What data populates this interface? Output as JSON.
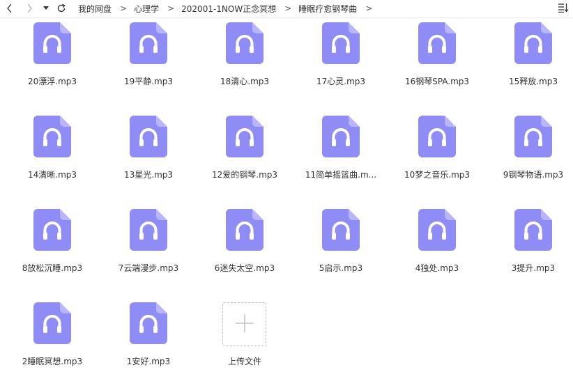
{
  "toolbar": {
    "back_icon": "chevron-left-icon",
    "forward_icon": "chevron-right-icon",
    "history_icon": "caret-down-icon",
    "refresh_icon": "refresh-icon",
    "sort_icon": "sort-icon"
  },
  "breadcrumb": {
    "items": [
      "我的网盘",
      "心理学",
      "202001-1NOW正念冥想",
      "睡眠疗愈钢琴曲"
    ],
    "separator": ">"
  },
  "files": [
    {
      "name": "20漂浮.mp3"
    },
    {
      "name": "19平静.mp3"
    },
    {
      "name": "18清心.mp3"
    },
    {
      "name": "17心灵.mp3"
    },
    {
      "name": "16钢琴SPA.mp3"
    },
    {
      "name": "15释放.mp3"
    },
    {
      "name": "14清晰.mp3"
    },
    {
      "name": "13星光.mp3"
    },
    {
      "name": "12爱的钢琴.mp3"
    },
    {
      "name": "11简单摇篮曲.m..."
    },
    {
      "name": "10梦之音乐.mp3"
    },
    {
      "name": "9钢琴物语.mp3"
    },
    {
      "name": "8放松沉睡.mp3"
    },
    {
      "name": "7云端漫步.mp3"
    },
    {
      "name": "6迷失太空.mp3"
    },
    {
      "name": "5启示.mp3"
    },
    {
      "name": "4独处.mp3"
    },
    {
      "name": "3提升.mp3"
    },
    {
      "name": "2睡眠冥想.mp3"
    },
    {
      "name": "1安好.mp3"
    }
  ],
  "upload": {
    "label": "上传文件",
    "icon": "plus-icon"
  },
  "colors": {
    "audio_icon": "#8f8cf6",
    "audio_icon_fold": "#b9b6ff",
    "headphone": "#ffffff"
  }
}
